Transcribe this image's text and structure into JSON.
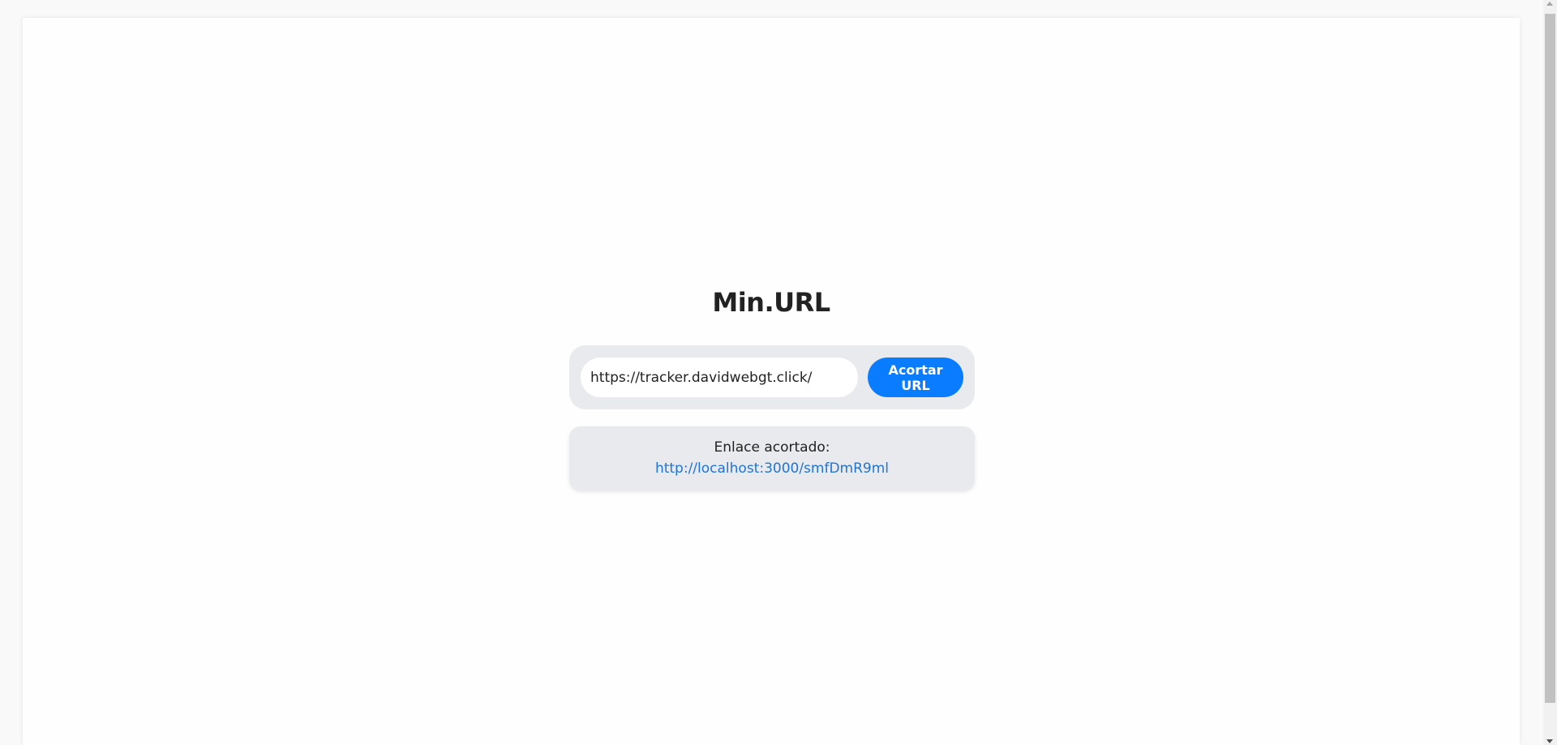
{
  "app": {
    "title": "Min.URL"
  },
  "form": {
    "url_value": "https://tracker.davidwebgt.click/",
    "submit_label": "Acortar URL"
  },
  "result": {
    "label": "Enlace acortado:",
    "link": "http://localhost:3000/smfDmR9ml"
  },
  "colors": {
    "accent": "#0a7cff",
    "card_background": "#e8eaed",
    "link": "#1f74d6"
  }
}
